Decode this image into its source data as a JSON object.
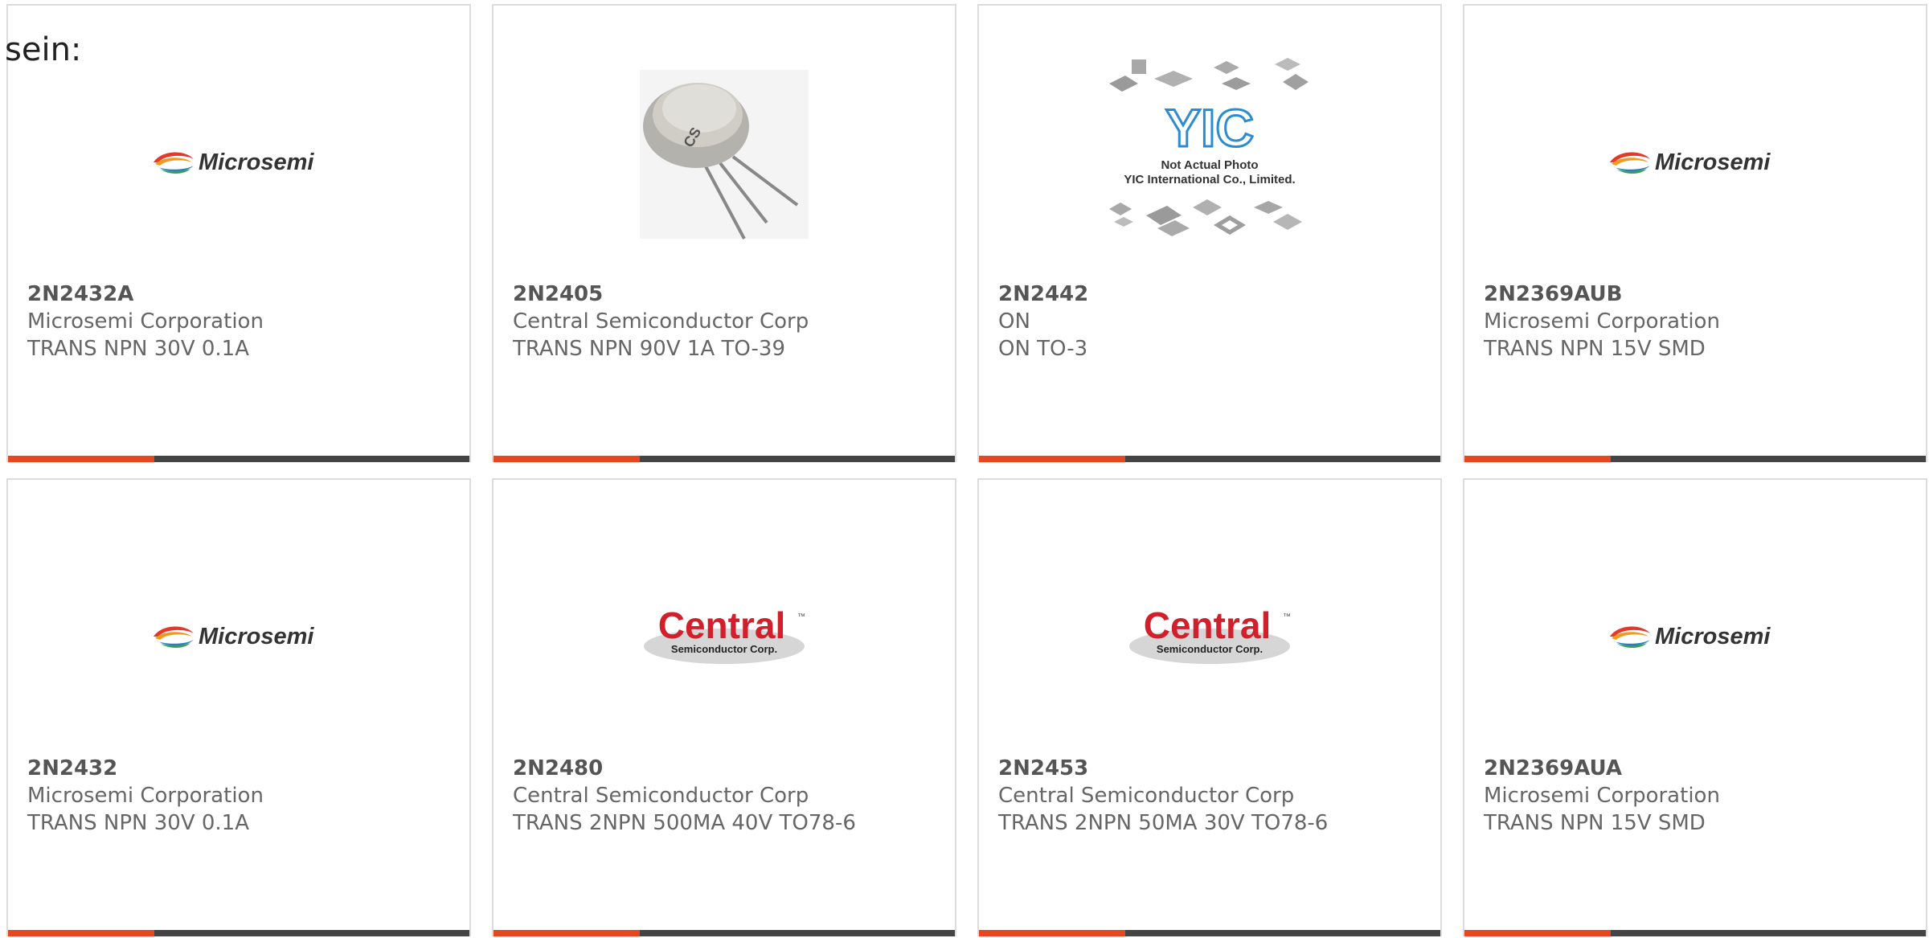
{
  "intro_text": "sein:",
  "colors": {
    "accent": "#e8461e",
    "bar": "#444444",
    "card_border": "#dcdcdc"
  },
  "cards": [
    {
      "part_number": "2N2432A",
      "manufacturer": "Microsemi Corporation",
      "description": "TRANS NPN 30V 0.1A",
      "image": "microsemi-logo",
      "logo_text": "Microsemi"
    },
    {
      "part_number": "2N2405",
      "manufacturer": "Central Semiconductor Corp",
      "description": "TRANS NPN 90V 1A TO-39",
      "image": "to39-transistor-photo"
    },
    {
      "part_number": "2N2442",
      "manufacturer": "ON",
      "description": "ON TO-3",
      "image": "yic-placeholder",
      "logo_text": "YIC",
      "caption_line1": "Not Actual Photo",
      "caption_line2": "YIC International Co., Limited."
    },
    {
      "part_number": "2N2369AUB",
      "manufacturer": "Microsemi Corporation",
      "description": "TRANS NPN 15V SMD",
      "image": "microsemi-logo",
      "logo_text": "Microsemi"
    },
    {
      "part_number": "2N2432",
      "manufacturer": "Microsemi Corporation",
      "description": "TRANS NPN 30V 0.1A",
      "image": "microsemi-logo",
      "logo_text": "Microsemi"
    },
    {
      "part_number": "2N2480",
      "manufacturer": "Central Semiconductor Corp",
      "description": "TRANS 2NPN 500MA 40V TO78-6",
      "image": "central-logo",
      "logo_text": "Central",
      "logo_subtext": "Semiconductor Corp."
    },
    {
      "part_number": "2N2453",
      "manufacturer": "Central Semiconductor Corp",
      "description": "TRANS 2NPN 50MA 30V TO78-6",
      "image": "central-logo",
      "logo_text": "Central",
      "logo_subtext": "Semiconductor Corp."
    },
    {
      "part_number": "2N2369AUA",
      "manufacturer": "Microsemi Corporation",
      "description": "TRANS NPN 15V SMD",
      "image": "microsemi-logo",
      "logo_text": "Microsemi"
    }
  ]
}
